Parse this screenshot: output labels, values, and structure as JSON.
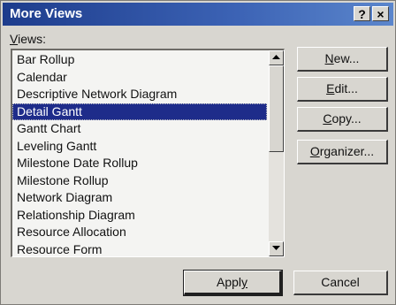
{
  "window": {
    "title": "More Views",
    "help_button": "?",
    "close_button": "×"
  },
  "views": {
    "label_accel": "V",
    "label_rest": "iews:",
    "items": [
      "Bar Rollup",
      "Calendar",
      "Descriptive Network Diagram",
      "Detail Gantt",
      "Gantt Chart",
      "Leveling Gantt",
      "Milestone Date Rollup",
      "Milestone Rollup",
      "Network Diagram",
      "Relationship Diagram",
      "Resource Allocation",
      "Resource Form"
    ],
    "selected": "Detail Gantt"
  },
  "buttons": {
    "new": {
      "accel": "N",
      "rest": "ew..."
    },
    "edit": {
      "accel": "E",
      "rest": "dit..."
    },
    "copy": {
      "accel": "C",
      "rest": "opy..."
    },
    "organizer": {
      "accel": "O",
      "rest": "rganizer..."
    },
    "apply": {
      "pre": "Appl",
      "accel": "y"
    },
    "cancel": {
      "label": "Cancel"
    }
  },
  "scrollbar": {
    "up_icon": "arrow-up-icon",
    "down_icon": "arrow-down-icon"
  }
}
